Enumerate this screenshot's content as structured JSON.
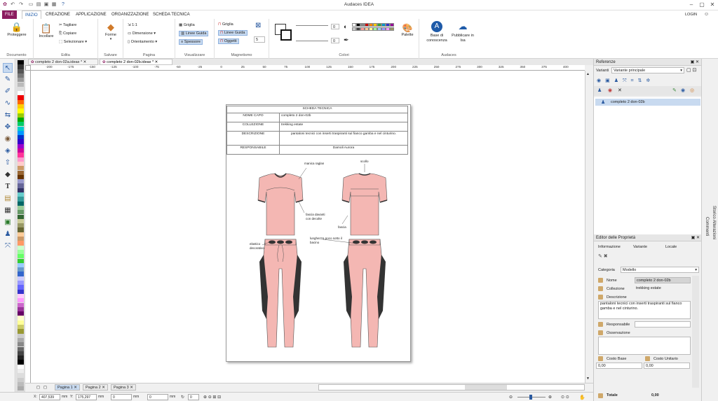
{
  "app": {
    "title": "Audaces IDEA",
    "login": "LOGIN"
  },
  "menu": {
    "file": "FILE",
    "tabs": [
      "INIZIO",
      "CREAZIONE",
      "APPLICAZIONE",
      "ORGANIZZAZIONE",
      "SCHEDA TECNICA"
    ]
  },
  "ribbon": {
    "documento": {
      "label": "Documento",
      "proteggere": "Proteggere"
    },
    "edita": {
      "label": "Edita",
      "incollare": "Incollare",
      "tagliare": "Tagliare",
      "copiare": "Copiare",
      "selezionare": "Selezionare"
    },
    "salvare": {
      "label": "Salvare",
      "forme": "Forme"
    },
    "pagina": {
      "label": "Pagina",
      "scale": "1:1",
      "dimensione": "Dimensione",
      "orientamento": "Orientamento"
    },
    "visualizzare": {
      "label": "Visualizzare",
      "griglia": "Griglia",
      "linee_guida": "Linee Guida",
      "spessore": "Spessore"
    },
    "magnetismo": {
      "label": "Magnetismo",
      "griglia": "Griglia",
      "linee_guida": "Linee Guida",
      "oggetti": "Oggetti",
      "value": "5"
    },
    "colori": {
      "label": "Colori",
      "val1": "0",
      "val2": "0",
      "palette": "Palette"
    },
    "audaces": {
      "label": "Audaces",
      "base": "Base di conoscenza",
      "pubblicare": "Pubblicare in Isa"
    }
  },
  "doc_tabs": [
    "completo 2 don-02a.ideax *",
    "completo 2 don-02b.ideax *"
  ],
  "ruler_ticks": [
    "-200",
    "-175",
    "-150",
    "-125",
    "-100",
    "-75",
    "-50",
    "-25",
    "0",
    "25",
    "50",
    "75",
    "100",
    "125",
    "150",
    "175",
    "200",
    "225",
    "250",
    "275",
    "300",
    "325",
    "350",
    "375",
    "400"
  ],
  "sheet": {
    "header": "SCHEDA TECNICA",
    "rows": [
      {
        "label": "NOME CAPO",
        "value": "completo 2 don-02b"
      },
      {
        "label": "COLLEZIONE",
        "value": "trekking estate"
      },
      {
        "label": "DESCRIZIONE",
        "value": "pantaloni tecnici con inserti traspiranti sul fianco gamba e nel cinturino."
      },
      {
        "label": "RESPONSABILE",
        "value": "Damoli Aurora"
      }
    ],
    "annotations": {
      "manica": "manica raglan",
      "scollo": "scollo",
      "fascia1": "fascia davanti con decolte",
      "fascia2": "fascia",
      "elastico": "elastico decorativo",
      "lunghezza": "lunghezza poco sotto il bacino"
    }
  },
  "page_tabs": [
    "Pagina 1",
    "Pagina 2",
    "Pagina 3"
  ],
  "status": {
    "x_label": "X:",
    "x": "407,539",
    "x_unit": "mm",
    "y_label": "Y:",
    "y": "175,297",
    "y_unit": "mm",
    "w": "0",
    "w_unit": "mm",
    "h": "0",
    "h_unit": "mm",
    "rot": "0"
  },
  "referenze": {
    "title": "Referenze",
    "varianti_label": "Varianti",
    "variante": "Variante principale",
    "item": "completo 2 don-02b"
  },
  "editor": {
    "title": "Editor delle Proprietà",
    "tabs": [
      "Informazione",
      "Variante",
      "Locale"
    ],
    "categoria_label": "Categoria",
    "categoria": "Modello",
    "nome_label": "Nome",
    "nome": "completo 2 don-02b",
    "collezione_label": "Collezione",
    "collezione": "trekking estate",
    "descrizione_label": "Descrizione",
    "descrizione": "pantaloni tecnici con inserti traspiranti sul fianco gamba e nel cinturino.",
    "responsabile_label": "Responsabile",
    "osservazione_label": "Osservazione",
    "costo_base_label": "Costo Base",
    "costo_unitario_label": "Costo Unitario",
    "costo_base": "0,00",
    "costo_unitario": "0,00",
    "totale_label": "Totale",
    "totale": "0,00"
  },
  "side_tabs": [
    "Storico Alterazioni",
    "Commenti"
  ],
  "colors": {
    "accent": "#8b1c5f",
    "garment": "#f4b7b3",
    "insert": "#333333"
  }
}
